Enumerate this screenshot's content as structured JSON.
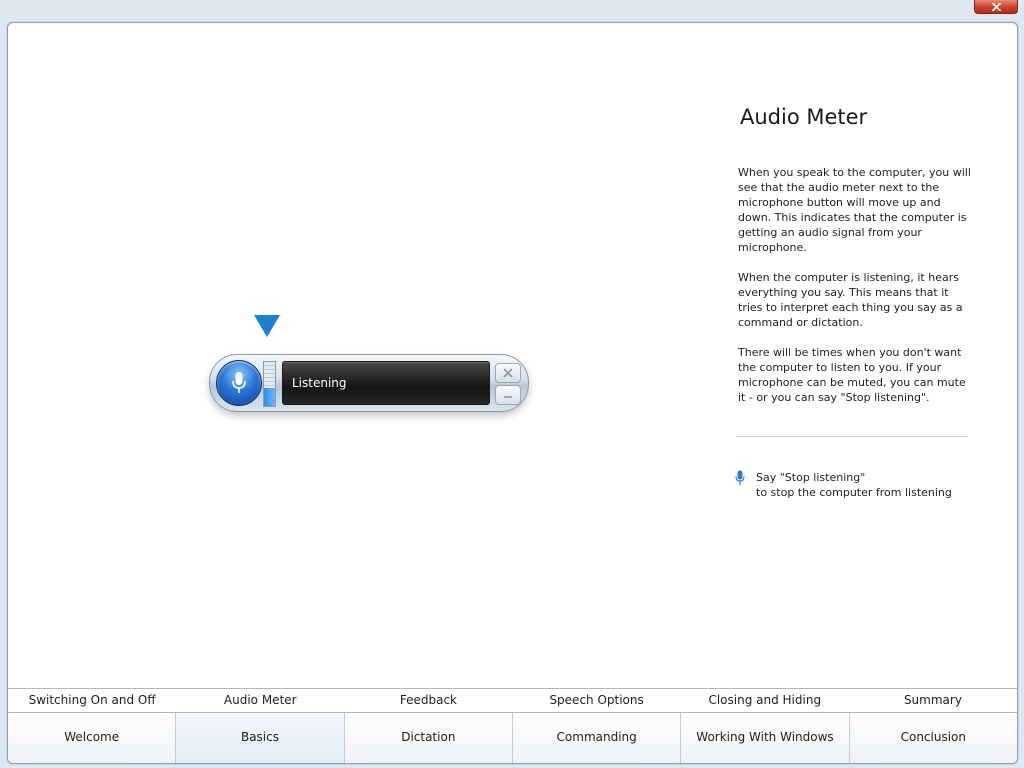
{
  "window": {
    "close_icon": "close-icon"
  },
  "widget": {
    "status_text": "Listening",
    "mic_icon": "microphone-icon",
    "audio_level": 0.42,
    "accent_color": "#1e7ed0",
    "pointer_icon": "down-triangle-icon"
  },
  "panel": {
    "title": "Audio Meter",
    "paragraphs": [
      "When you speak to the computer, you will see that the audio meter next to the microphone button will move up and down. This indicates that the computer is getting an audio signal from your microphone.",
      "When the computer is listening, it hears everything you say. This means that it tries to interpret each thing you say as a command or dictation.",
      "There will be times when you don't want the computer to listen to you. If your microphone can be muted, you can mute it - or you can say \"Stop listening\"."
    ],
    "hint_line1": "Say \"Stop listening\"",
    "hint_line2": "to stop the computer from listening"
  },
  "sub_tabs": [
    {
      "label": "Switching On and Off"
    },
    {
      "label": "Audio Meter"
    },
    {
      "label": "Feedback"
    },
    {
      "label": "Speech Options"
    },
    {
      "label": "Closing and Hiding"
    },
    {
      "label": "Summary"
    }
  ],
  "main_tabs": [
    {
      "label": "Welcome"
    },
    {
      "label": "Basics"
    },
    {
      "label": "Dictation"
    },
    {
      "label": "Commanding"
    },
    {
      "label": "Working With Windows"
    },
    {
      "label": "Conclusion"
    }
  ]
}
